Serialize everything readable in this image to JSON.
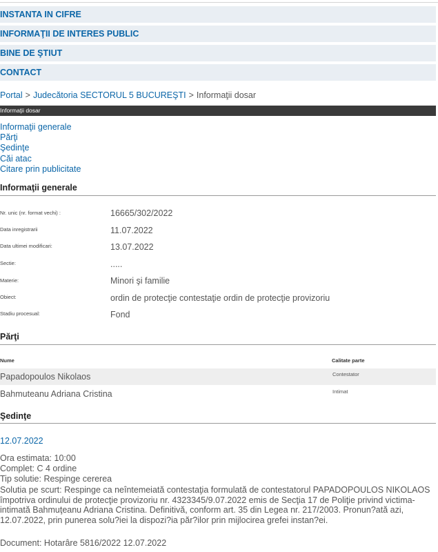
{
  "nav": {
    "items": [
      "INSTANTA IN CIFRE",
      "INFORMAŢII DE INTERES PUBLIC",
      "BINE DE ŞTIUT",
      "CONTACT"
    ]
  },
  "breadcrumb": {
    "home": "Portal",
    "court": "Judecătoria SECTORUL 5 BUCUREŞTI",
    "current": "Informaţii dosar",
    "separator": ">"
  },
  "header_bar": {
    "title": "Informaţii dosar"
  },
  "tabs": [
    "Informaţii generale",
    "Părţi",
    "Şedinţe",
    "Căi atac",
    "Citare prin publicitate"
  ],
  "general": {
    "title": "Informaţii generale",
    "fields": [
      {
        "label": "Nr. unic (nr. format vechi) :",
        "value": "16665/302/2022"
      },
      {
        "label": "Data inregistrarii",
        "value": "11.07.2022"
      },
      {
        "label": "Data ultimei modificari:",
        "value": "13.07.2022"
      },
      {
        "label": "Sectie:",
        "value": "....."
      },
      {
        "label": "Materie:",
        "value": "Minori şi familie"
      },
      {
        "label": "Obiect:",
        "value": "ordin de protecţie contestaţie ordin de protecţie provizoriu"
      },
      {
        "label": "Stadiu procesual:",
        "value": "Fond"
      }
    ]
  },
  "parties": {
    "title": "Părţi",
    "col_name": "Nume",
    "col_role": "Calitate parte",
    "rows": [
      {
        "name": "Papadopoulos Nikolaos",
        "role": "Contestator"
      },
      {
        "name": "Bahmuteanu Adriana Cristina",
        "role": "Intimat"
      }
    ]
  },
  "hearings": {
    "title": "Şedinţe",
    "date": "12.07.2022",
    "ora": "Ora estimata: 10:00",
    "complet": "Complet: C 4 ordine",
    "tip": "Tip solutie: Respinge cererea",
    "solutie": "Solutia pe scurt: Respinge ca neîntemeiată contestaţia formulată de contestatorul PAPADOPOULOS NIKOLAOS împotriva ordinului de protecţie provizoriu nr. 4323345/9.07.2022 emis de Secţia 17 de Poliţie privind victima- intimată Bahmuţeanu Adriana Cristina. Definitivă, conform art. 35 din Legea nr. 217/2003. Pronun?ată azi, 12.07.2022, prin punerea solu?iei la dispozi?ia păr?ilor prin mijlocirea grefei instan?ei.",
    "document": "Document: Hotarâre  5816/2022  12.07.2022"
  }
}
